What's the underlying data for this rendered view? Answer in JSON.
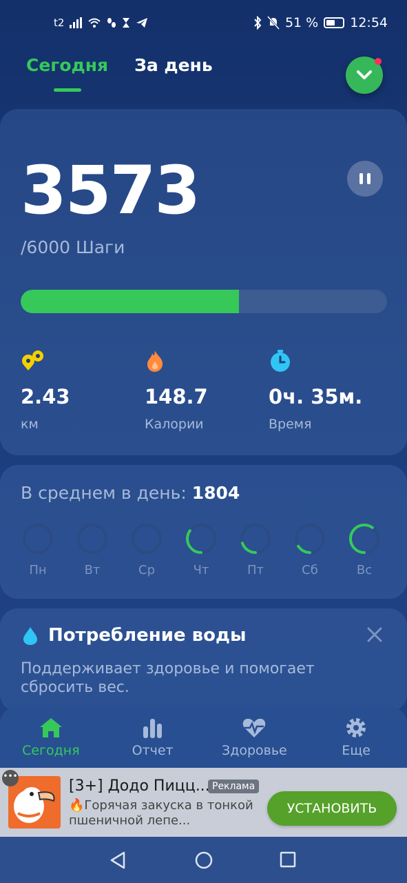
{
  "status_bar": {
    "carrier": "t2",
    "battery": "51 %",
    "time": "12:54"
  },
  "tabs": [
    {
      "label": "Сегодня",
      "active": true
    },
    {
      "label": "За день",
      "active": false
    }
  ],
  "steps": {
    "count": "3573",
    "goal": "/6000 Шаги",
    "progress_fraction": 0.5955
  },
  "stats": [
    {
      "icon": "distance-icon",
      "value": "2.43",
      "label": "км"
    },
    {
      "icon": "fire-icon",
      "value": "148.7",
      "label": "Калории"
    },
    {
      "icon": "timer-icon",
      "value": "0ч. 35м.",
      "label": "Время"
    }
  ],
  "average": {
    "label": "В среднем в день: ",
    "value": "1804"
  },
  "week": [
    {
      "label": "Пн",
      "progress": 0
    },
    {
      "label": "Вт",
      "progress": 0
    },
    {
      "label": "Ср",
      "progress": 0
    },
    {
      "label": "Чт",
      "progress": 0.35
    },
    {
      "label": "Пт",
      "progress": 0.2
    },
    {
      "label": "Сб",
      "progress": 0.16
    },
    {
      "label": "Вс",
      "progress": 0.6
    }
  ],
  "water": {
    "title": "Потребление воды",
    "description": "Поддерживает здоровье и помогает сбросить вес."
  },
  "bottom_nav": [
    {
      "icon": "home-icon",
      "label": "Сегодня",
      "active": true
    },
    {
      "icon": "bar-chart-icon",
      "label": "Отчет",
      "active": false
    },
    {
      "icon": "heart-pulse-icon",
      "label": "Здоровье",
      "active": false
    },
    {
      "icon": "gear-icon",
      "label": "Еще",
      "active": false
    }
  ],
  "ad": {
    "dots": "•••",
    "title": "[3+] Додо Пицц...",
    "badge": "Реклама",
    "description": "🔥Горячая закуска в тонкой пшеничной лепе...",
    "button": "УСТАНОВИТЬ"
  },
  "colors": {
    "accent": "#36c95a",
    "background": "#1c3c7a",
    "muted_text": "#a7bad9"
  }
}
